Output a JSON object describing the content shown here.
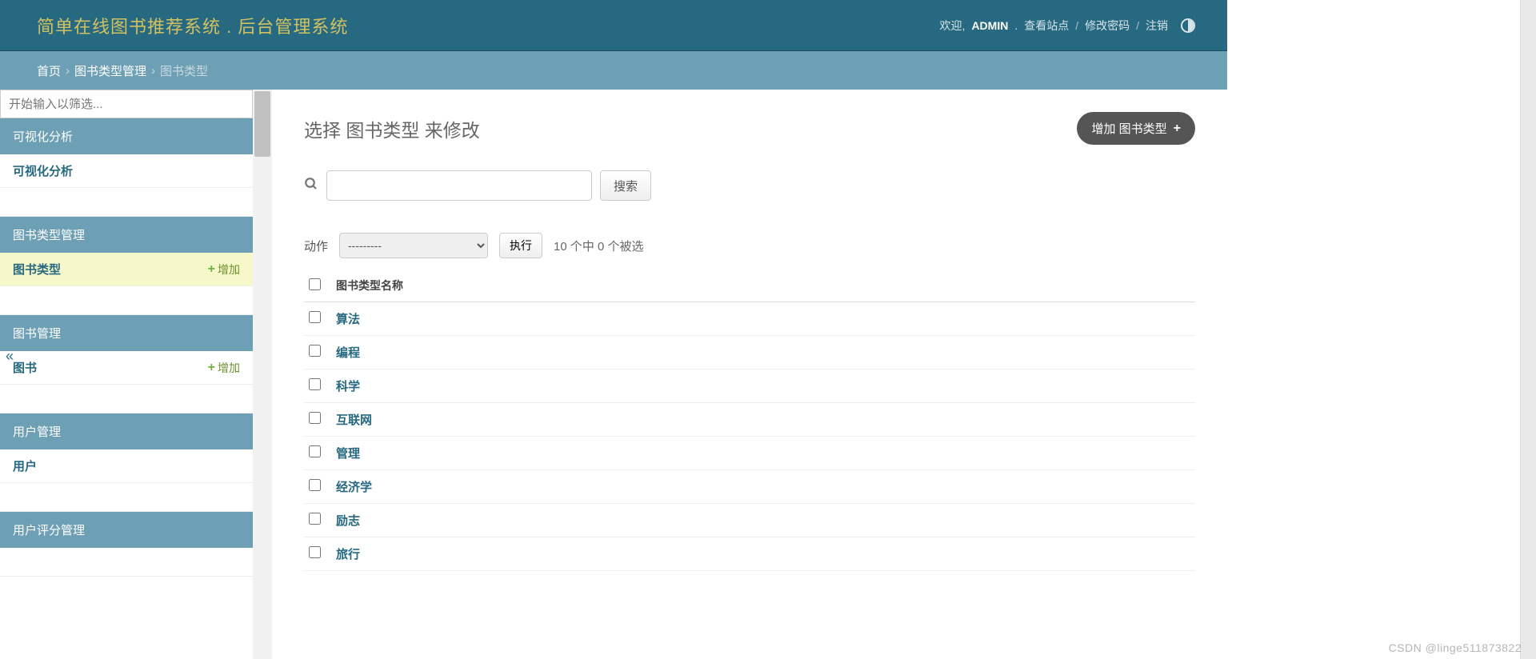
{
  "header": {
    "title": "简单在线图书推荐系统 . 后台管理系统",
    "welcome": "欢迎,",
    "user": "ADMIN",
    "view_site": "查看站点",
    "change_password": "修改密码",
    "logout": "注销"
  },
  "breadcrumb": {
    "home": "首页",
    "section": "图书类型管理",
    "current": "图书类型"
  },
  "sidebar": {
    "filter_placeholder": "开始输入以筛选...",
    "add_label": "增加",
    "sections": [
      {
        "header": "可视化分析",
        "items": [
          {
            "label": "可视化分析",
            "add": false,
            "active": false
          }
        ]
      },
      {
        "header": "图书类型管理",
        "items": [
          {
            "label": "图书类型",
            "add": true,
            "active": true
          }
        ]
      },
      {
        "header": "图书管理",
        "items": [
          {
            "label": "图书",
            "add": true,
            "active": false
          }
        ]
      },
      {
        "header": "用户管理",
        "items": [
          {
            "label": "用户",
            "add": false,
            "active": false
          }
        ]
      },
      {
        "header": "用户评分管理",
        "items": []
      }
    ]
  },
  "main": {
    "page_title": "选择 图书类型 来修改",
    "add_button": "增加 图书类型",
    "search_button": "搜索",
    "actions": {
      "label": "动作",
      "placeholder": "---------",
      "go": "执行",
      "count": "10 个中 0 个被选"
    },
    "table": {
      "header": "图书类型名称",
      "rows": [
        "算法",
        "编程",
        "科学",
        "互联网",
        "管理",
        "经济学",
        "励志",
        "旅行"
      ]
    }
  },
  "collapse_icon": "«",
  "watermark": "CSDN @linge511873822"
}
